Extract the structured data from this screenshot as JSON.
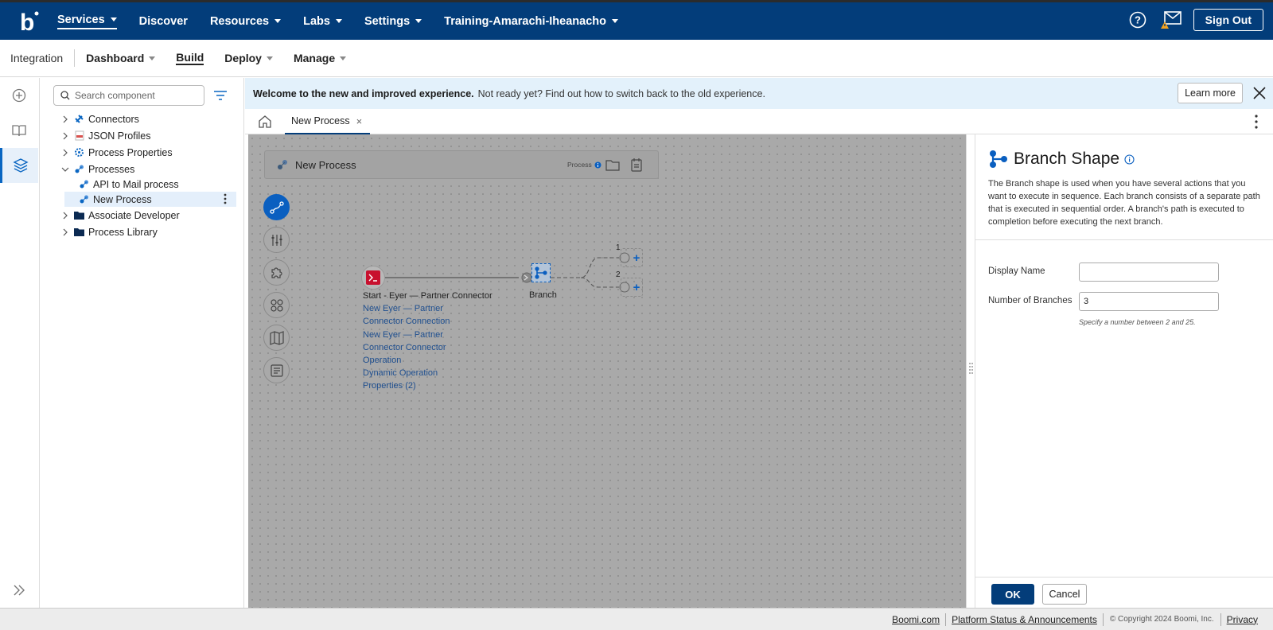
{
  "topnav": {
    "logo_letter": "b",
    "items": [
      {
        "label": "Services",
        "caret": true
      },
      {
        "label": "Discover",
        "caret": false
      },
      {
        "label": "Resources",
        "caret": true
      },
      {
        "label": "Labs",
        "caret": true
      },
      {
        "label": "Settings",
        "caret": true
      },
      {
        "label": "Training-Amarachi-Iheanacho",
        "caret": true
      }
    ],
    "signout_label": "Sign Out"
  },
  "subnav": {
    "section": "Integration",
    "items": [
      {
        "label": "Dashboard",
        "caret": true
      },
      {
        "label": "Build",
        "caret": false
      },
      {
        "label": "Deploy",
        "caret": true
      },
      {
        "label": "Manage",
        "caret": true
      }
    ]
  },
  "tree": {
    "search_placeholder": "Search component",
    "items": [
      {
        "label": "Connectors",
        "icon": "connector-icon"
      },
      {
        "label": "JSON Profiles",
        "icon": "json-icon"
      },
      {
        "label": "Process Properties",
        "icon": "gear-icon"
      },
      {
        "label": "Processes",
        "icon": "process-icon"
      },
      {
        "label": "API to Mail process",
        "icon": "process-icon"
      },
      {
        "label": "New Process",
        "icon": "process-icon"
      },
      {
        "label": "Associate Developer",
        "icon": "folder-icon"
      },
      {
        "label": "Process Library",
        "icon": "folder-icon"
      }
    ]
  },
  "banner": {
    "bold": "Welcome to the new and improved experience.",
    "message": "Not ready yet? Find out how to switch back to the old experience.",
    "learn_more": "Learn more"
  },
  "tabs": {
    "active": "New Process",
    "close": "×"
  },
  "canvas": {
    "process_title": "New Process",
    "process_type": "Process",
    "start_label": "Start - Eyer — Partner Connector",
    "start_links": [
      "New Eyer — Partner",
      "Connector Connection",
      "New Eyer — Partner",
      "Connector Connector",
      "Operation",
      "Dynamic Operation",
      "Properties (2)"
    ],
    "branch_label": "Branch",
    "branch_numbers": [
      "1",
      "2"
    ],
    "add_symbol": "+"
  },
  "panel": {
    "title": "Branch Shape",
    "description": "The Branch shape is used when you have several actions that you want to execute in sequence. Each branch consists of a separate path that is executed in sequential order. A branch's path is executed to completion before executing the next branch.",
    "display_name_label": "Display Name",
    "display_name_value": "",
    "branches_label": "Number of Branches",
    "branches_value": "3",
    "hint": "Specify a number between 2 and 25.",
    "ok": "OK",
    "cancel": "Cancel"
  },
  "footer": {
    "links": [
      "Boomi.com",
      "Platform Status & Announcements"
    ],
    "copyright": "© Copyright 2024 Boomi, Inc.",
    "privacy": "Privacy"
  },
  "colors": {
    "nav_bg": "#033d7a",
    "accent": "#0a5fc0",
    "banner_bg": "#e3f1fb",
    "canvas_bg": "#a9a9a9"
  }
}
